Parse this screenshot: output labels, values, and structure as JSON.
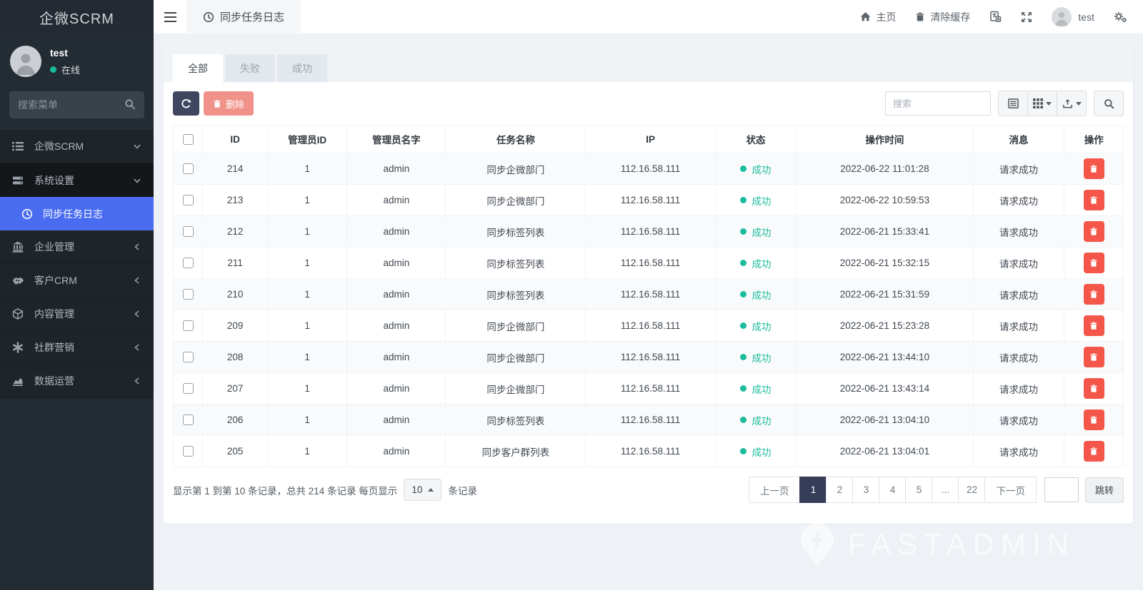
{
  "app": {
    "logo": "企微SCRM",
    "watermark": "FASTADMIN"
  },
  "colors": {
    "accent_blue": "#4a6cf1",
    "success": "#1abc9c",
    "danger": "#f4564a",
    "salmon_disabled": "#f0928a",
    "dark_navy": "#3f4660",
    "page_active": "#363d59"
  },
  "sidebar": {
    "user": {
      "name": "test",
      "status": "在线"
    },
    "search_placeholder": "搜索菜单",
    "menu": [
      {
        "icon": "list-icon",
        "label": "企微SCRM",
        "state": "expanded"
      },
      {
        "icon": "server-icon",
        "label": "系统设置",
        "state": "expanded"
      },
      {
        "icon": "clock-icon",
        "label": "同步任务日志",
        "active": true
      },
      {
        "icon": "bank-icon",
        "label": "企业管理",
        "state": "collapsed"
      },
      {
        "icon": "handshake-icon",
        "label": "客户CRM",
        "state": "collapsed"
      },
      {
        "icon": "cube-icon",
        "label": "内容管理",
        "state": "collapsed"
      },
      {
        "icon": "asterisk-icon",
        "label": "社群营销",
        "state": "collapsed"
      },
      {
        "icon": "chart-area-icon",
        "label": "数据运营",
        "state": "collapsed"
      }
    ]
  },
  "topbar": {
    "active_tab": "同步任务日志",
    "home_label": "主页",
    "clear_cache_label": "清除缓存",
    "username": "test"
  },
  "filter_tabs": [
    {
      "label": "全部",
      "active": true
    },
    {
      "label": "失败",
      "active": false
    },
    {
      "label": "成功",
      "active": false
    }
  ],
  "toolbar": {
    "delete_label": "删除",
    "search_placeholder": "搜索"
  },
  "table": {
    "columns": [
      "ID",
      "管理员ID",
      "管理员名字",
      "任务名称",
      "IP",
      "状态",
      "操作时间",
      "消息",
      "操作"
    ],
    "rows": [
      {
        "id": "214",
        "admin_id": "1",
        "admin_name": "admin",
        "task": "同步企微部门",
        "ip": "112.16.58.111",
        "status": "成功",
        "time": "2022-06-22 11:01:28",
        "message": "请求成功"
      },
      {
        "id": "213",
        "admin_id": "1",
        "admin_name": "admin",
        "task": "同步企微部门",
        "ip": "112.16.58.111",
        "status": "成功",
        "time": "2022-06-22 10:59:53",
        "message": "请求成功"
      },
      {
        "id": "212",
        "admin_id": "1",
        "admin_name": "admin",
        "task": "同步标签列表",
        "ip": "112.16.58.111",
        "status": "成功",
        "time": "2022-06-21 15:33:41",
        "message": "请求成功"
      },
      {
        "id": "211",
        "admin_id": "1",
        "admin_name": "admin",
        "task": "同步标签列表",
        "ip": "112.16.58.111",
        "status": "成功",
        "time": "2022-06-21 15:32:15",
        "message": "请求成功"
      },
      {
        "id": "210",
        "admin_id": "1",
        "admin_name": "admin",
        "task": "同步标签列表",
        "ip": "112.16.58.111",
        "status": "成功",
        "time": "2022-06-21 15:31:59",
        "message": "请求成功"
      },
      {
        "id": "209",
        "admin_id": "1",
        "admin_name": "admin",
        "task": "同步企微部门",
        "ip": "112.16.58.111",
        "status": "成功",
        "time": "2022-06-21 15:23:28",
        "message": "请求成功"
      },
      {
        "id": "208",
        "admin_id": "1",
        "admin_name": "admin",
        "task": "同步企微部门",
        "ip": "112.16.58.111",
        "status": "成功",
        "time": "2022-06-21 13:44:10",
        "message": "请求成功"
      },
      {
        "id": "207",
        "admin_id": "1",
        "admin_name": "admin",
        "task": "同步企微部门",
        "ip": "112.16.58.111",
        "status": "成功",
        "time": "2022-06-21 13:43:14",
        "message": "请求成功"
      },
      {
        "id": "206",
        "admin_id": "1",
        "admin_name": "admin",
        "task": "同步标签列表",
        "ip": "112.16.58.111",
        "status": "成功",
        "time": "2022-06-21 13:04:10",
        "message": "请求成功"
      },
      {
        "id": "205",
        "admin_id": "1",
        "admin_name": "admin",
        "task": "同步客户群列表",
        "ip": "112.16.58.111",
        "status": "成功",
        "time": "2022-06-21 13:04:01",
        "message": "请求成功"
      }
    ]
  },
  "pagination": {
    "info_prefix": "显示第 1 到第 10 条记录，总共 214 条记录 每页显示",
    "page_size": "10",
    "info_suffix": "条记录",
    "prev_label": "上一页",
    "next_label": "下一页",
    "pages": [
      "1",
      "2",
      "3",
      "4",
      "5",
      "...",
      "22"
    ],
    "active_page": "1",
    "jump_label": "跳转"
  }
}
